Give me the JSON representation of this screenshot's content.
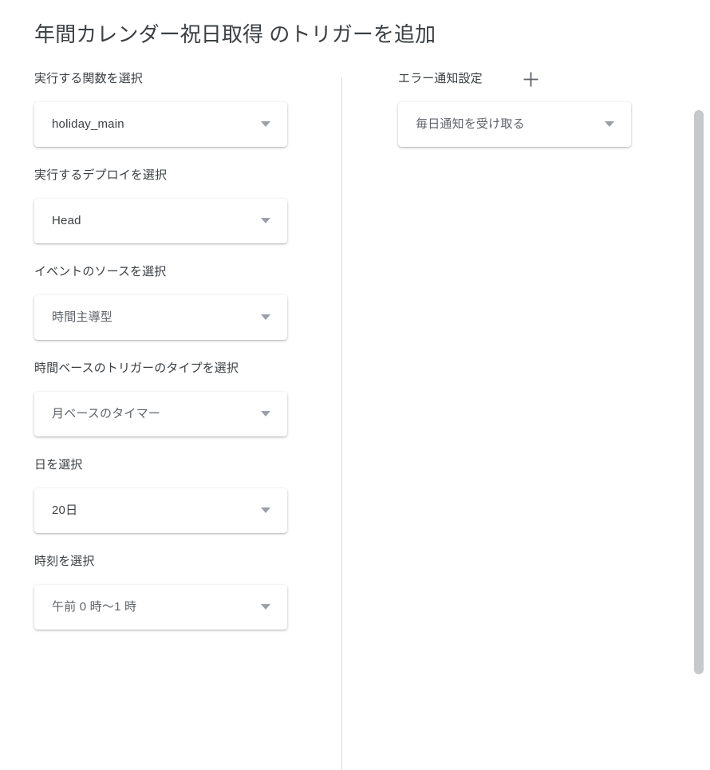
{
  "dialog": {
    "title": "年間カレンダー祝日取得 のトリガーを追加"
  },
  "left_column": {
    "fields": [
      {
        "label": "実行する関数を選択",
        "value": "holiday_main",
        "muted": false,
        "name": "function-select"
      },
      {
        "label": "実行するデプロイを選択",
        "value": "Head",
        "muted": false,
        "name": "deployment-select"
      },
      {
        "label": "イベントのソースを選択",
        "value": "時間主導型",
        "muted": true,
        "name": "event-source-select"
      },
      {
        "label": "時間ベースのトリガーのタイプを選択",
        "value": "月ベースのタイマー",
        "muted": true,
        "name": "time-trigger-type-select"
      },
      {
        "label": "日を選択",
        "value": "20日",
        "muted": false,
        "name": "day-select"
      },
      {
        "label": "時刻を選択",
        "value": "午前 0 時〜1 時",
        "muted": true,
        "name": "time-select"
      }
    ]
  },
  "right_column": {
    "header_label": "エラー通知設定",
    "add_button_icon": "plus-icon",
    "fields": [
      {
        "label": "",
        "value": "毎日通知を受け取る",
        "muted": true,
        "name": "failure-notification-select"
      }
    ]
  },
  "icons": {
    "dropdown_arrow": "chevron-down-icon",
    "add": "plus-icon"
  },
  "colors": {
    "background": "#ffffff",
    "title_text": "#3c4043",
    "label_text": "#3c4043",
    "value_text": "#3c4043",
    "muted_value_text": "#5f6368",
    "divider": "#d6d7da",
    "arrow": "#9aa0a6",
    "plus_icon": "#5f6368",
    "scrollbar_thumb": "#c6c8ca"
  },
  "scrollbar": {
    "name": "vertical-scrollbar"
  }
}
